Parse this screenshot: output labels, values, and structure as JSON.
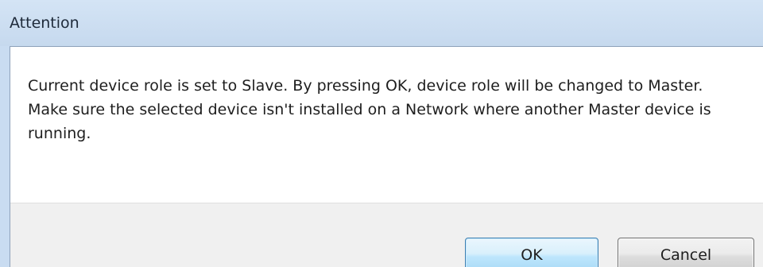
{
  "dialog": {
    "title": "Attention",
    "message": "Current device role is set to Slave. By pressing OK, device role will be changed to Master. Make sure the selected device isn't installed on a Network where another Master device is running.",
    "buttons": {
      "ok_label": "OK",
      "cancel_label": "Cancel"
    }
  },
  "colors": {
    "title_bar": "#c9dcf1",
    "button_strip": "#f0f0f0",
    "default_button_border": "#3c7fb1"
  }
}
